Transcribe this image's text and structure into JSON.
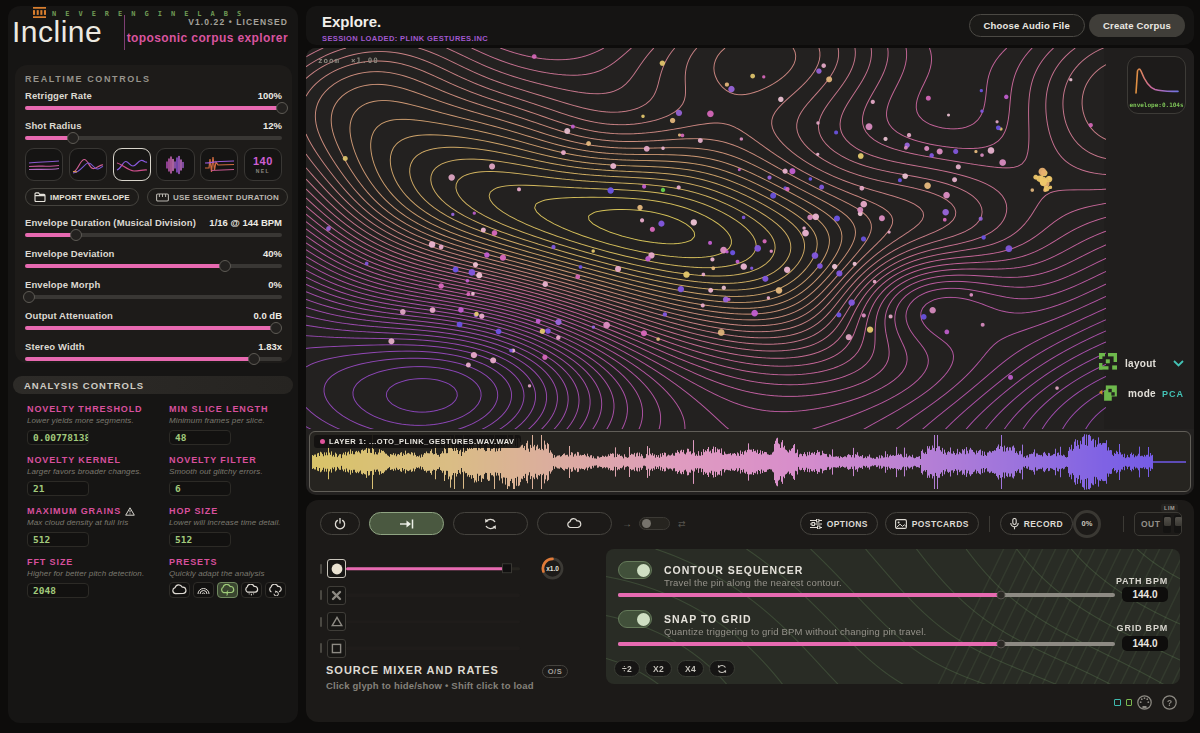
{
  "brand": {
    "company": "NEVERENGINELABS",
    "product": "Incline",
    "version_line": "V1.0.22 • LICENSED",
    "tagline": "toposonic corpus explorer"
  },
  "realtime": {
    "title": "REALTIME CONTROLS",
    "sliders": [
      {
        "label": "Retrigger Rate",
        "value": "100%",
        "fill": 100
      },
      {
        "label": "Shot Radius",
        "value": "12%",
        "fill": 18.5
      }
    ],
    "envelope_thumbs": [
      {
        "icon": "curve-flat",
        "selected": false
      },
      {
        "icon": "curve-bumps",
        "selected": false
      },
      {
        "icon": "curve-zigzag",
        "selected": true
      },
      {
        "icon": "curve-burst",
        "selected": false
      },
      {
        "icon": "curve-spike",
        "selected": false
      },
      {
        "icon": "text",
        "selected": false,
        "text": "140",
        "subtext": "NEL"
      }
    ],
    "buttons": [
      {
        "label": "IMPORT ENVELOPE",
        "icon": "folder"
      },
      {
        "label": "USE SEGMENT DURATION",
        "icon": "ruler"
      }
    ],
    "env_sliders": [
      {
        "label": "Envelope Duration (Musical Division)",
        "value": "1/16 @ 144 BPM",
        "fill": 20
      },
      {
        "label": "Envelope Deviation",
        "value": "40%",
        "fill": 78
      },
      {
        "label": "Envelope Morph",
        "value": "0%",
        "fill": 1.5
      },
      {
        "label": "Output Attenuation",
        "value": "0.0 dB",
        "fill": 97.5
      },
      {
        "label": "Stereo Width",
        "value": "1.83x",
        "fill": 89
      }
    ]
  },
  "analysis": {
    "title": "ANALYSIS CONTROLS",
    "fields": [
      {
        "label": "NOVELTY THRESHOLD",
        "desc": "Lower yields more segments.",
        "value": "0.007781385",
        "warn": false
      },
      {
        "label": "MIN SLICE LENGTH",
        "desc": "Minimum frames per slice.",
        "value": "48",
        "warn": false
      },
      {
        "label": "NOVELTY KERNEL",
        "desc": "Larger favors broader changes.",
        "value": "21",
        "warn": false
      },
      {
        "label": "NOVELTY FILTER",
        "desc": "Smooth out glitchy errors.",
        "value": "6",
        "warn": false
      },
      {
        "label": "MAXIMUM GRAINS",
        "desc": "Max cloud density at full Iris",
        "value": "512",
        "warn": true
      },
      {
        "label": "HOP SIZE",
        "desc": "Lower will increase time detail.",
        "value": "512",
        "warn": false
      },
      {
        "label": "FFT SIZE",
        "desc": "Higher for better pitch detection.",
        "value": "2048",
        "warn": false
      },
      {
        "label": "PRESETS",
        "desc": "Quickly adapt the analysis",
        "presets": true,
        "warn": false
      }
    ],
    "presets": [
      {
        "icon": "cloud",
        "selected": false
      },
      {
        "icon": "rainbow",
        "selected": false
      },
      {
        "icon": "cloud-bolt",
        "selected": true
      },
      {
        "icon": "cloud-rain",
        "selected": false
      },
      {
        "icon": "cloud-cycle",
        "selected": false
      }
    ]
  },
  "header": {
    "title": "Explore.",
    "session": "SESSION LOADED: PLINK GESTURES.INC",
    "choose_label": "Choose Audio File",
    "create_label": "Create Corpus"
  },
  "map": {
    "zoom_label": "zoom",
    "zoom_value": "×1.00",
    "envelope_caption": "envelope:0.104s",
    "layout_label": "layout",
    "mode_label": "mode",
    "mode_value": "PCA"
  },
  "wave": {
    "label": "LAYER 1: ...OTO_PLINK_GESTURES.WAV.WAV"
  },
  "transport": {
    "options_label": "OPTIONS",
    "postcards_label": "POSTCARDS",
    "record_label": "RECORD",
    "knob_value": "0%",
    "out_label": "OUT",
    "lim_label": "LIM"
  },
  "mixer": {
    "title": "SOURCE MIXER AND RATES",
    "subtitle": "Click glyph to hide/show • Shift click to load",
    "badge": "O/S",
    "knob_label": "x1.0",
    "rows": [
      {
        "glyph": "circle",
        "active": true,
        "fill": 92.5,
        "has_slider": true
      },
      {
        "glyph": "cross",
        "active": false,
        "fill": 0,
        "has_slider": false
      },
      {
        "glyph": "triangle",
        "active": false,
        "fill": 0,
        "has_slider": false
      },
      {
        "glyph": "square",
        "active": false,
        "fill": 0,
        "has_slider": false
      }
    ]
  },
  "sequencer": {
    "rows": [
      {
        "title": "CONTOUR SEQUENCER",
        "desc": "Travel the pin along the nearest contour.",
        "bpm_label": "PATH BPM",
        "bpm": "144.0",
        "fill": 77
      },
      {
        "title": "SNAP TO GRID",
        "desc": "Quantize triggering to grid BPM without changing pin travel.",
        "bpm_label": "GRID BPM",
        "bpm": "144.0",
        "fill": 77
      }
    ],
    "mult_buttons": [
      "÷2",
      "X2",
      "X4"
    ]
  }
}
